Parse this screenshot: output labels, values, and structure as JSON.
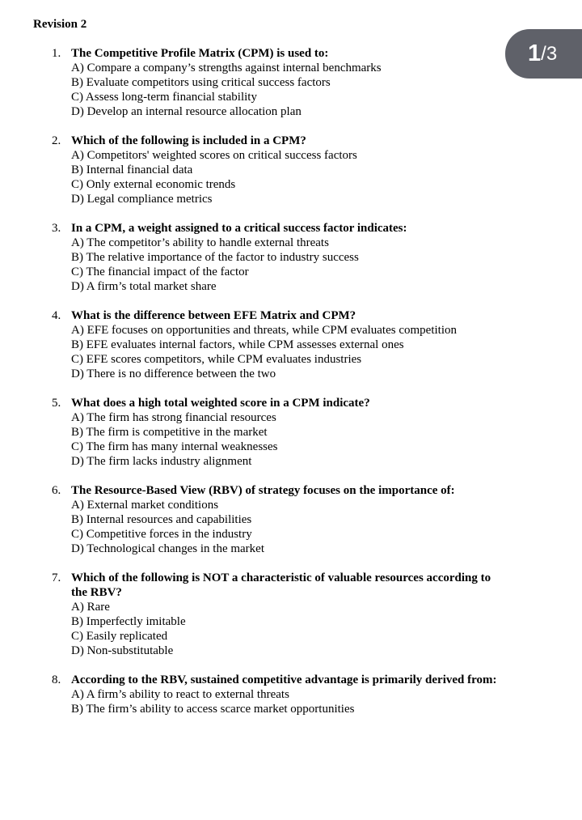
{
  "document": {
    "title": "Revision 2"
  },
  "page_indicator": {
    "current": "1",
    "separator": "/",
    "total": "3"
  },
  "questions": [
    {
      "number": "1.",
      "text": "The Competitive Profile Matrix (CPM) is used to:",
      "options": [
        "A) Compare a company’s strengths against internal benchmarks",
        "B) Evaluate competitors using critical success factors",
        "C) Assess long-term financial stability",
        "D) Develop an internal resource allocation plan"
      ]
    },
    {
      "number": "2.",
      "text": "Which of the following is included in a CPM?",
      "options": [
        "A) Competitors' weighted scores on critical success factors",
        "B) Internal financial data",
        "C) Only external economic trends",
        "D) Legal compliance metrics"
      ]
    },
    {
      "number": "3.",
      "text": "In a CPM, a weight assigned to a critical success factor indicates:",
      "options": [
        "A) The competitor’s ability to handle external threats",
        "B) The relative importance of the factor to industry success",
        "C) The financial impact of the factor",
        "D) A firm’s total market share"
      ]
    },
    {
      "number": "4.",
      "text": "What is the difference between EFE Matrix and CPM?",
      "options": [
        "A) EFE focuses on opportunities and threats, while CPM evaluates competition",
        "B) EFE evaluates internal factors, while CPM assesses external ones",
        "C) EFE scores competitors, while CPM evaluates industries",
        "D) There is no difference between the two"
      ]
    },
    {
      "number": "5.",
      "text": "What does a high total weighted score in a CPM indicate?",
      "options": [
        "A) The firm has strong financial resources",
        "B) The firm is competitive in the market",
        "C) The firm has many internal weaknesses",
        "D) The firm lacks industry alignment"
      ]
    },
    {
      "number": "6.",
      "text": "The Resource-Based View (RBV) of strategy focuses on the importance of:",
      "options": [
        "A) External market conditions",
        "B) Internal resources and capabilities",
        "C) Competitive forces in the industry",
        "D) Technological changes in the market"
      ]
    },
    {
      "number": "7.",
      "text": "Which of the following is NOT a characteristic of valuable resources according to the RBV?",
      "options": [
        "A) Rare",
        "B) Imperfectly imitable",
        "C) Easily replicated",
        "D) Non-substitutable"
      ]
    },
    {
      "number": "8.",
      "text": "According to the RBV, sustained competitive advantage is primarily derived from:",
      "options": [
        "A) A firm’s ability to react to external threats",
        "B) The firm’s ability to access scarce market opportunities"
      ]
    }
  ]
}
